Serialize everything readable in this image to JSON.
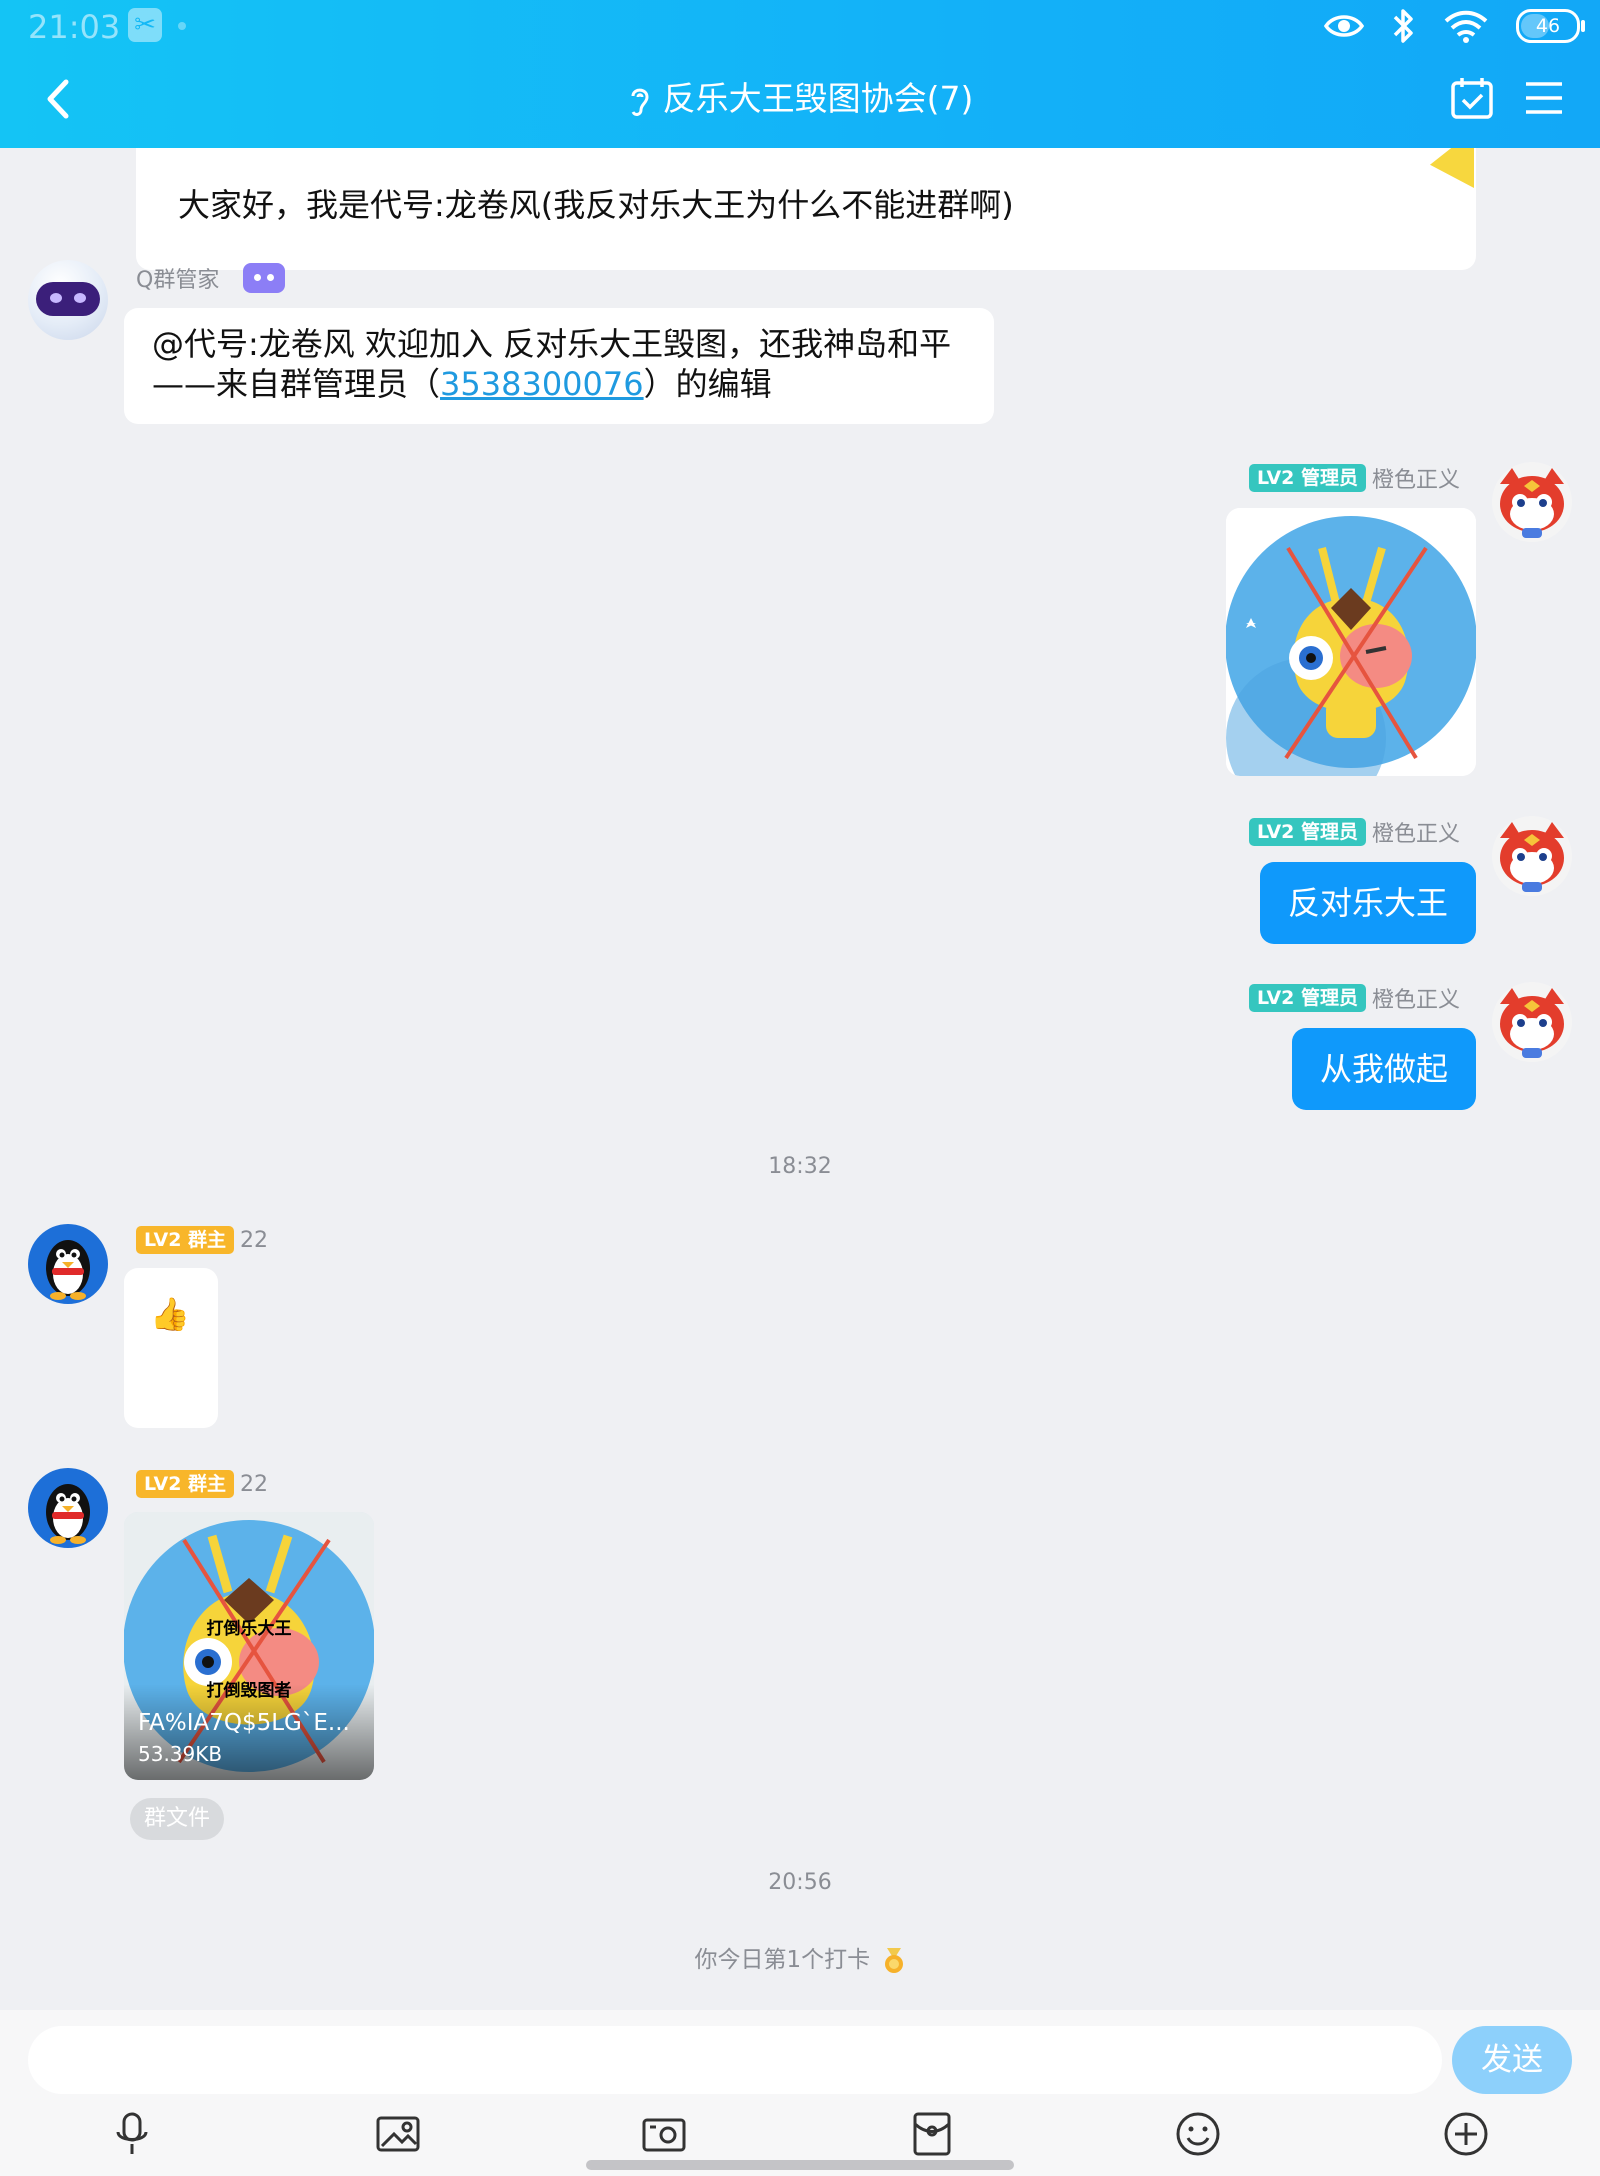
{
  "status_bar": {
    "time": "21:03",
    "battery": "46"
  },
  "header": {
    "title": "反乐大王毁图协会(7)"
  },
  "pinned_intro": {
    "text": "大家好，我是代号:龙卷风(我反对乐大王为什么不能进群啊)"
  },
  "messages": {
    "bot": {
      "sender": "Q群管家",
      "text_line1": "@代号:龙卷风 欢迎加入 反对乐大王毁图，还我神岛和平",
      "text_line2_prefix": "——来自群管理员（",
      "link": "3538300076",
      "text_line2_suffix": "）的编辑"
    },
    "admin_image": {
      "badge": "LV2 管理员",
      "sender": "橙色正义"
    },
    "admin_text1": {
      "badge": "LV2 管理员",
      "sender": "橙色正义",
      "text": "反对乐大王"
    },
    "admin_text2": {
      "badge": "LV2 管理员",
      "sender": "橙色正义",
      "text": "从我做起"
    },
    "time1": "18:32",
    "owner_emoji": {
      "badge": "LV2 群主",
      "sender": "22",
      "text": "👍"
    },
    "owner_file": {
      "badge": "LV2 群主",
      "sender": "22",
      "image_text_top": "打倒乐大王",
      "image_text_bottom": "打倒毁图者",
      "file_name": "FA%IA7Q$5LG`E...",
      "file_size": "53.39KB",
      "tag": "群文件"
    },
    "time2": "20:56",
    "checkin": "你今日第1个打卡"
  },
  "input": {
    "placeholder": "",
    "value": "",
    "send_label": "发送"
  },
  "toolbar": [
    "microphone-icon",
    "image-icon",
    "camera-icon",
    "red-packet-icon",
    "emoji-icon",
    "plus-icon"
  ],
  "colors": {
    "header": "#13b1f8",
    "bubble_blue": "#0f99fb",
    "send_disabled": "#8dd0fb",
    "admin_badge": "#35c6bf",
    "owner_badge": "#f8b62a"
  }
}
